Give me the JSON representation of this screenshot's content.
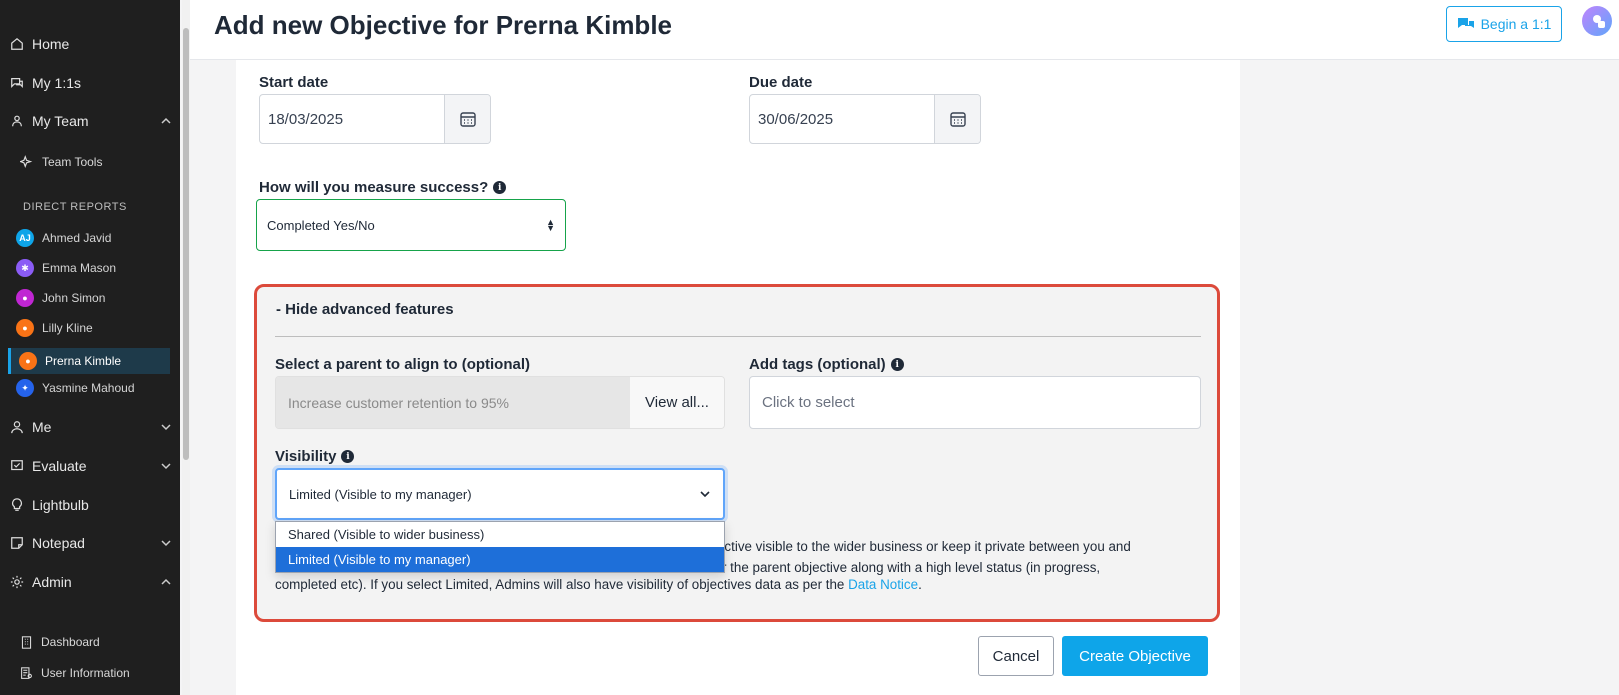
{
  "sidebar": {
    "nav": [
      {
        "label": "Home",
        "icon": "home-icon"
      },
      {
        "label": "My 1:1s",
        "icon": "chat-icon"
      },
      {
        "label": "My Team",
        "icon": "team-icon"
      }
    ],
    "team_tools": "Team Tools",
    "direct_reports_label": "DIRECT REPORTS",
    "reports": [
      {
        "name": "Ahmed Javid",
        "initials": "AJ",
        "color": "#0ea5e9"
      },
      {
        "name": "Emma Mason",
        "color": "#8b5cf6"
      },
      {
        "name": "John Simon",
        "color": "#c026d3"
      },
      {
        "name": "Lilly Kline",
        "color": "#f97316"
      },
      {
        "name": "Prerna Kimble",
        "color": "#f97316"
      },
      {
        "name": "Yasmine Mahoud",
        "color": "#2563eb"
      }
    ],
    "lower_nav": [
      {
        "label": "Me"
      },
      {
        "label": "Evaluate"
      },
      {
        "label": "Lightbulb"
      },
      {
        "label": "Notepad"
      },
      {
        "label": "Admin"
      }
    ],
    "admin_items": [
      "Dashboard",
      "User Information"
    ]
  },
  "header": {
    "title": "Add new Objective for Prerna Kimble",
    "begin_button": "Begin a 1:1"
  },
  "form": {
    "start_date_label": "Start date",
    "start_date": "18/03/2025",
    "due_date_label": "Due date",
    "due_date": "30/06/2025",
    "measure_label": "How will you measure success?",
    "measure_value": "Completed Yes/No",
    "advanced_toggle": "- Hide advanced features",
    "parent_label": "Select a parent to align to (optional)",
    "parent_placeholder": "Increase customer retention to 95%",
    "view_all": "View all...",
    "tags_label": "Add tags (optional)",
    "tags_placeholder": "Click to select",
    "visibility_label": "Visibility",
    "visibility_value": "Limited (Visible to my manager)",
    "visibility_options": [
      "Shared (Visible to wider business)",
      "Limited (Visible to my manager)"
    ],
    "notice_line1": "jective visible to the wider business or keep it private between you and",
    "notice_line2": "r the parent objective along with a high level status (in progress,",
    "notice_line3": "completed etc). If you select Limited, Admins will also have visibility of objectives data as per the ",
    "notice_link": "Data Notice",
    "notice_end": ".",
    "cancel": "Cancel",
    "create": "Create Objective"
  },
  "colors": {
    "accent": "#1aa3e8",
    "highlight_border": "#dc4a3b",
    "sidebar_bg": "#1f1f1f"
  }
}
